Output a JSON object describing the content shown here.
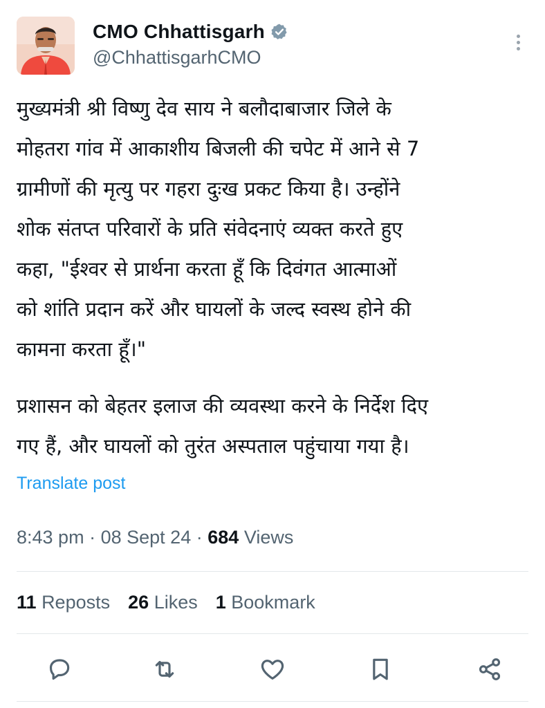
{
  "tweet": {
    "author_name": "CMO Chhattisgarh",
    "author_handle": "@ChhattisgarhCMO",
    "verified": true,
    "paragraph1": "मुख्यमंत्री श्री विष्णु देव साय ने बलौदाबाजार जिले के\nमोहतरा गांव में आकाशीय बिजली की चपेट में आने से 7\nग्रामीणों की मृत्यु पर गहरा दुःख प्रकट किया है। उन्होंने\nशोक संतप्त परिवारों के प्रति संवेदनाएं व्यक्त करते हुए\nकहा, \"ईश्वर से प्रार्थना करता हूँ कि दिवंगत आत्माओं\nको शांति प्रदान करें और घायलों के जल्द स्वस्थ होने की\nकामना करता हूँ।\"",
    "paragraph2": "प्रशासन को बेहतर इलाज की व्यवस्था करने के निर्देश दिए\nगए हैं, और घायलों को तुरंत अस्पताल पहुंचाया गया है।",
    "translate_label": "Translate post",
    "time": "8:43 pm",
    "date": "08 Sept 24",
    "views_count": "684",
    "views_label": "Views",
    "separator": "·"
  },
  "stats": {
    "reposts_count": "11",
    "reposts_label": "Reposts",
    "likes_count": "26",
    "likes_label": "Likes",
    "bookmarks_count": "1",
    "bookmarks_label": "Bookmark"
  },
  "icons": {
    "more": "more-vertical-icon",
    "reply": "reply-icon",
    "repost": "repost-icon",
    "like": "like-icon",
    "bookmark": "bookmark-icon",
    "share": "share-icon",
    "verified": "verified-badge-icon"
  },
  "colors": {
    "link": "#1d9bf0",
    "secondary_text": "#536471",
    "primary_text": "#0f1419",
    "verified_badge": "#829aab"
  }
}
